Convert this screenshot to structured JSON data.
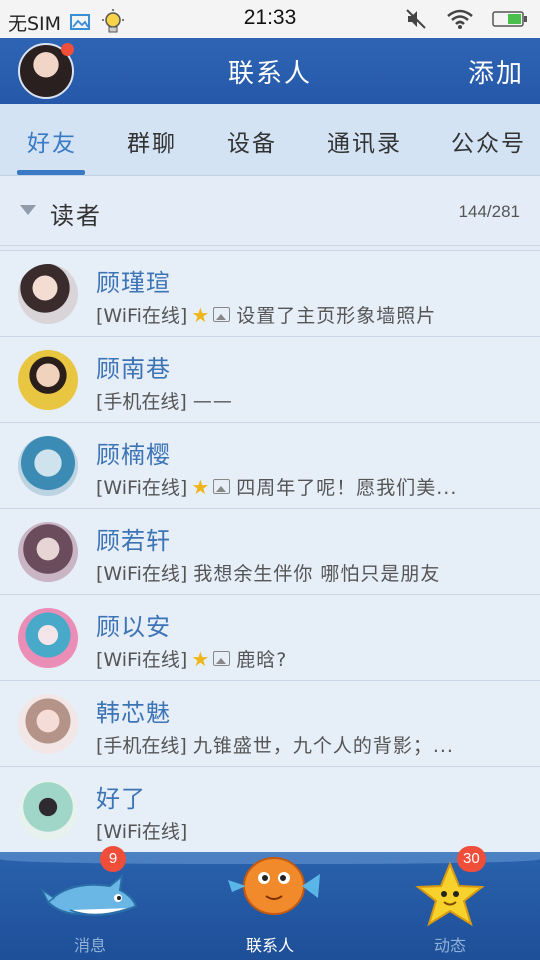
{
  "status_bar": {
    "carrier": "无SIM",
    "time": "21:33"
  },
  "header": {
    "title": "联系人",
    "add_label": "添加"
  },
  "tabs": [
    {
      "label": "好友",
      "active": true
    },
    {
      "label": "群聊",
      "active": false
    },
    {
      "label": "设备",
      "active": false
    },
    {
      "label": "通讯录",
      "active": false
    },
    {
      "label": "公众号",
      "active": false
    }
  ],
  "group": {
    "name": "读者",
    "count": "144/281"
  },
  "contacts": [
    {
      "name": "顾瑾瑄",
      "status": "[WiFi在线]",
      "signature": "设置了主页形象墙照片"
    },
    {
      "name": "顾南巷",
      "status": "[手机在线]",
      "signature": "——"
    },
    {
      "name": "顾楠樱",
      "status": "[WiFi在线]",
      "signature": "四周年了呢！愿我们美..."
    },
    {
      "name": "顾若轩",
      "status": "[WiFi在线]",
      "signature": "我想余生伴你 哪怕只是朋友"
    },
    {
      "name": "顾以安",
      "status": "[WiFi在线]",
      "signature": "鹿晗?"
    },
    {
      "name": "韩芯魅",
      "status": "[手机在线]",
      "signature": "九锥盛世，九个人的背影；..."
    },
    {
      "name": "好了",
      "status": "[WiFi在线]",
      "signature": ""
    }
  ],
  "bottom_nav": [
    {
      "label": "消息",
      "badge": "9"
    },
    {
      "label": "联系人",
      "badge": ""
    },
    {
      "label": "动态",
      "badge": "30"
    }
  ],
  "colors": {
    "accent": "#3a79c4",
    "header": "#2a5eae",
    "badge": "#ef4e3a",
    "star": "#f1b51c"
  }
}
